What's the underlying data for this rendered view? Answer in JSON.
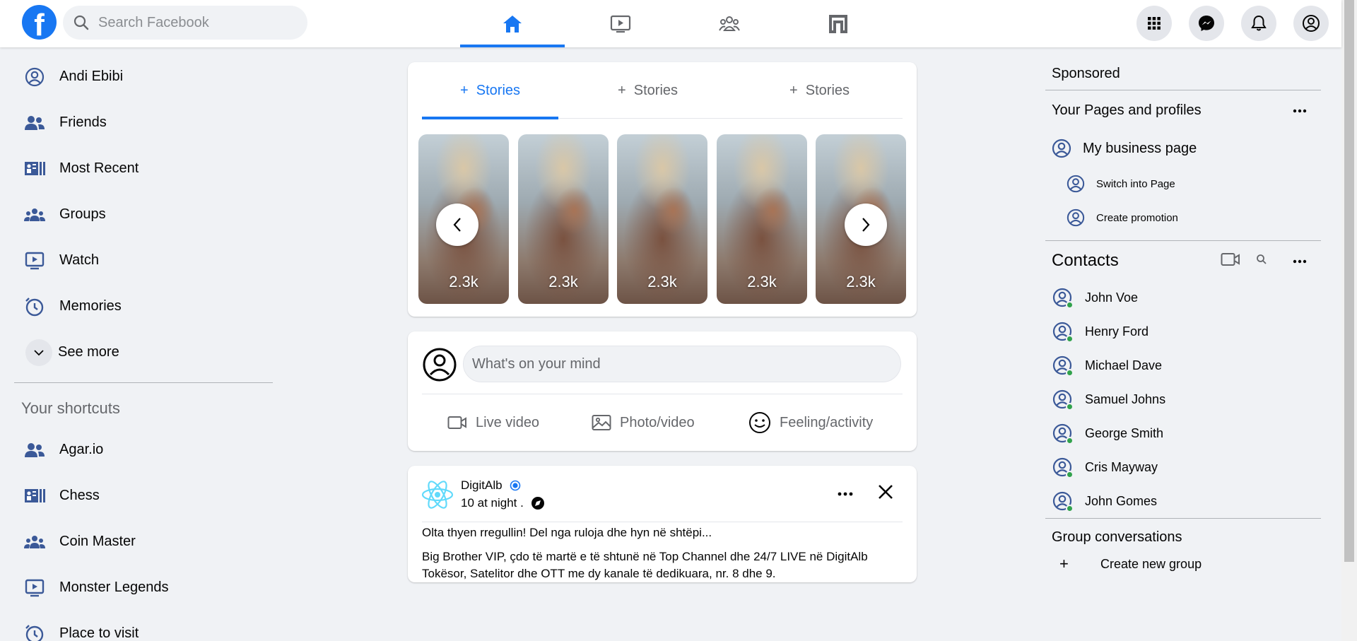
{
  "header": {
    "logo": "f",
    "search_placeholder": "Search Facebook",
    "nav_tabs": [
      "home-icon",
      "watch-icon",
      "groups-icon",
      "gaming-icon"
    ],
    "right_buttons": [
      "menu-grid-icon",
      "messenger-icon",
      "notifications-icon",
      "account-icon"
    ]
  },
  "left_sidebar": {
    "items": [
      {
        "label": "Andi Ebibi",
        "icon": "profile-icon"
      },
      {
        "label": "Friends",
        "icon": "friends-icon"
      },
      {
        "label": "Most Recent",
        "icon": "most-recent-icon"
      },
      {
        "label": "Groups",
        "icon": "groups-icon"
      },
      {
        "label": "Watch",
        "icon": "watch-icon"
      },
      {
        "label": "Memories",
        "icon": "memories-icon"
      }
    ],
    "see_more": "See more",
    "shortcuts_title": "Your shortcuts",
    "shortcuts": [
      {
        "label": "Agar.io",
        "icon": "friends-icon"
      },
      {
        "label": "Chess",
        "icon": "most-recent-icon"
      },
      {
        "label": "Coin Master",
        "icon": "groups-icon"
      },
      {
        "label": "Monster Legends",
        "icon": "watch-icon"
      },
      {
        "label": "Place to visit",
        "icon": "memories-icon"
      }
    ]
  },
  "stories": {
    "tabs": [
      "Stories",
      "Stories",
      "Stories"
    ],
    "tab_prefix": "+",
    "cards": [
      "2.3k",
      "2.3k",
      "2.3k",
      "2.3k",
      "2.3k"
    ]
  },
  "composer": {
    "placeholder": "What's on your mind",
    "actions": [
      "Live video",
      "Photo/video",
      "Feeling/activity"
    ]
  },
  "post": {
    "page_name": "DigitAlb",
    "time": "10 at night .",
    "text1": "Olta thyen rregullin! Del nga ruloja dhe hyn në shtëpi...",
    "text2": "Big Brother VIP, çdo të martë e të shtunë në Top Channel dhe 24/7 LIVE në DigitAlb Tokësor, Satelitor dhe OTT me dy kanale të dedikuara, nr. 8 dhe 9."
  },
  "right_sidebar": {
    "sponsored": "Sponsored",
    "pages_title": "Your Pages and profiles",
    "business_page": "My business page",
    "switch_page": "Switch into Page",
    "create_promotion": "Create promotion",
    "contacts_title": "Contacts",
    "contacts": [
      "John Voe",
      "Henry Ford",
      "Michael Dave",
      "Samuel Johns",
      "George Smith",
      "Cris Mayway",
      "John Gomes"
    ],
    "group_conversations": "Group conversations",
    "create_group": "Create new group"
  },
  "colors": {
    "brand": "#1877f2",
    "online": "#31a24c",
    "icon_blue": "#3b5998"
  }
}
